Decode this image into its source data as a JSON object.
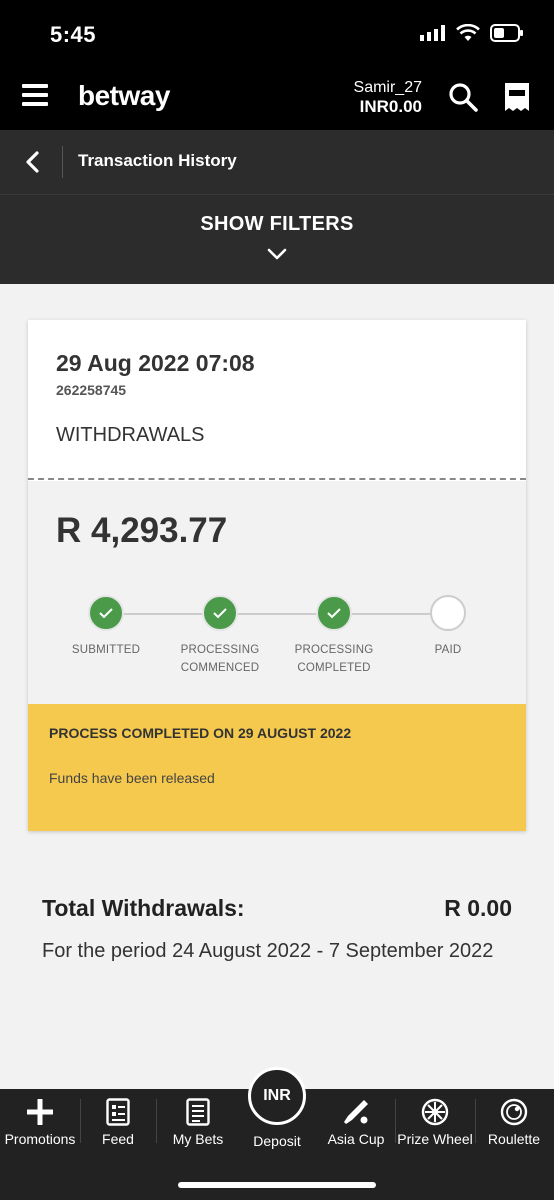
{
  "status_bar": {
    "time": "5:45"
  },
  "header": {
    "logo": "betway",
    "username": "Samir_27",
    "balance": "INR0.00"
  },
  "subheader": {
    "title": "Transaction History"
  },
  "filters": {
    "label": "SHOW FILTERS"
  },
  "transaction": {
    "date": "29 Aug 2022 07:08",
    "id": "262258745",
    "type": "WITHDRAWALS",
    "amount": "R 4,293.77",
    "steps": [
      {
        "label_line1": "SUBMITTED",
        "label_line2": "",
        "status": "done"
      },
      {
        "label_line1": "PROCESSING",
        "label_line2": "COMMENCED",
        "status": "done"
      },
      {
        "label_line1": "PROCESSING",
        "label_line2": "COMPLETED",
        "status": "done"
      },
      {
        "label_line1": "PAID",
        "label_line2": "",
        "status": "pending"
      }
    ],
    "notice_title": "PROCESS COMPLETED ON 29 AUGUST 2022",
    "notice_text": "Funds have been released"
  },
  "totals": {
    "label": "Total Withdrawals:",
    "value": "R 0.00",
    "period": "For the period 24 August 2022 - 7 September 2022"
  },
  "bottom_nav": {
    "items": [
      {
        "label": "Promotions",
        "icon": "plus-icon"
      },
      {
        "label": "Feed",
        "icon": "feed-icon"
      },
      {
        "label": "My Bets",
        "icon": "mybets-icon"
      },
      {
        "label": "Deposit",
        "icon": "deposit-icon",
        "badge": "INR"
      },
      {
        "label": "Asia Cup",
        "icon": "cricket-icon"
      },
      {
        "label": "Prize Wheel",
        "icon": "wheel-icon"
      },
      {
        "label": "Roulette",
        "icon": "roulette-icon"
      }
    ]
  },
  "colors": {
    "header_bg": "#000000",
    "subheader_bg": "#2c2c2c",
    "success": "#4a9a4a",
    "notice_bg": "#f5c94e",
    "nav_bg": "#222222"
  }
}
